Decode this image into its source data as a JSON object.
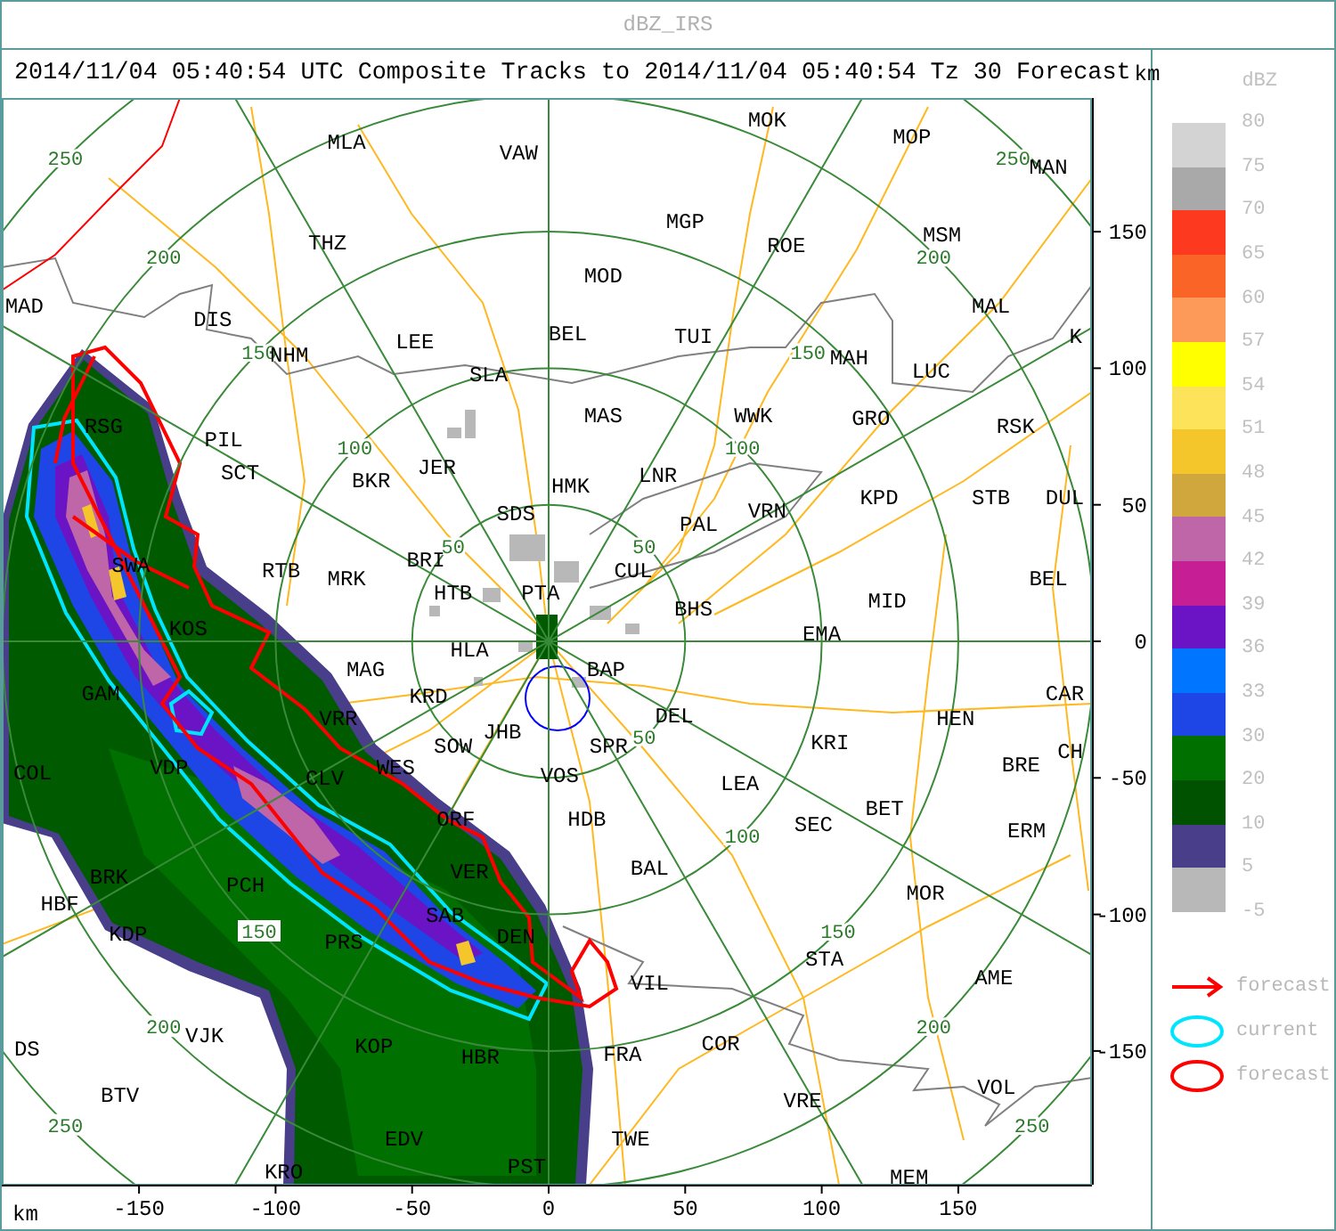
{
  "window": {
    "title": "dBZ_IRS"
  },
  "header": {
    "text": "2014/11/04 05:40:54 UTC Composite Tracks to 2014/11/04 05:40:54 Tz 30 Forecast"
  },
  "map": {
    "stations": [
      "MLA",
      "VAW",
      "MOK",
      "MOP",
      "MAN",
      "THZ",
      "MGP",
      "ROE",
      "MSM",
      "MOD",
      "MAD",
      "MAL",
      "DIS",
      "LEE",
      "BEL",
      "TUI",
      "K",
      "NHM",
      "SLA",
      "MAH",
      "LUC",
      "RSG",
      "MAS",
      "WWK",
      "GRO",
      "RSK",
      "PIL",
      "SCT",
      "BKR",
      "JER",
      "HMK",
      "LNR",
      "KPD",
      "STB",
      "DUL",
      "SDS",
      "VRN",
      "PAL",
      "SWA",
      "RTB",
      "MRK",
      "BRI",
      "CUL",
      "BEL",
      "HTB",
      "PTA",
      "BHS",
      "MID",
      "KOS",
      "HLA",
      "EMA",
      "MAG",
      "BAP",
      "GAM",
      "KRD",
      "CAR",
      "VRR",
      "DEL",
      "HEN",
      "SOW",
      "JHB",
      "SPR",
      "KRI",
      "CH",
      "COL",
      "VDP",
      "CLV",
      "WES",
      "VOS",
      "LEA",
      "BRE",
      "ORF",
      "HDB",
      "SEC",
      "BET",
      "ERM",
      "HBF",
      "BRK",
      "PCH",
      "VER",
      "BAL",
      "MOR",
      "KDP",
      "PRS",
      "SAB",
      "DEN",
      "VIL",
      "STA",
      "AME",
      "DS",
      "VJK",
      "KOP",
      "HBR",
      "FRA",
      "COR",
      "BTV",
      "VRE",
      "VOL",
      "EDV",
      "TWE",
      "KRO",
      "PST",
      "MEM"
    ],
    "range_labels": [
      "50",
      "100",
      "150",
      "200",
      "250",
      "50",
      "100",
      "150",
      "200",
      "250",
      "50",
      "100",
      "150",
      "200",
      "250",
      "150",
      "200",
      "250"
    ],
    "x_axis": {
      "label": "km",
      "ticks": [
        "-150",
        "-100",
        "-50",
        "0",
        "50",
        "100",
        "150"
      ]
    },
    "y_axis": {
      "label": "km",
      "ticks": [
        "150",
        "100",
        "50",
        "0",
        "-50",
        "-100",
        "-150"
      ]
    }
  },
  "legend": {
    "title": "dBZ",
    "ticks": [
      "80",
      "75",
      "70",
      "65",
      "60",
      "57",
      "54",
      "51",
      "48",
      "45",
      "42",
      "39",
      "36",
      "33",
      "30",
      "20",
      "10",
      "5",
      "-5"
    ],
    "bins": [
      {
        "color": "#d3d3d3"
      },
      {
        "color": "#a9a9a9"
      },
      {
        "color": "#fd3a20"
      },
      {
        "color": "#fb6427"
      },
      {
        "color": "#fd9a5a"
      },
      {
        "color": "#ffff00"
      },
      {
        "color": "#fce35a"
      },
      {
        "color": "#f4c62c"
      },
      {
        "color": "#cfa73c"
      },
      {
        "color": "#be66a7"
      },
      {
        "color": "#c61f95"
      },
      {
        "color": "#6b14c6"
      },
      {
        "color": "#0075ff"
      },
      {
        "color": "#1e46e6"
      },
      {
        "color": "#007000"
      },
      {
        "color": "#005200"
      },
      {
        "color": "#483e8a"
      },
      {
        "color": "#b8b8b8"
      }
    ],
    "keys": [
      {
        "kind": "arrow",
        "label": "forecast"
      },
      {
        "kind": "current",
        "label": "current"
      },
      {
        "kind": "forecast",
        "label": "forecast"
      }
    ]
  }
}
